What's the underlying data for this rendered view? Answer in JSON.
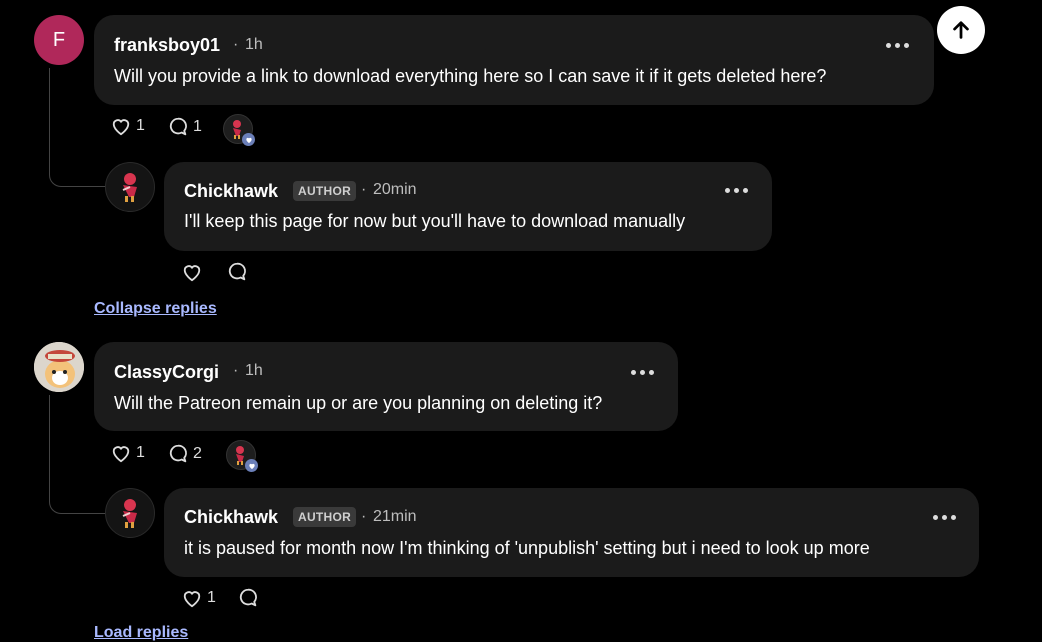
{
  "comments": [
    {
      "avatar_letter": "F",
      "author": "franksboy01",
      "time": "1h",
      "text": "Will you provide a link to download everything here so I can save it if it gets deleted here?",
      "likes": "1",
      "replies": "1",
      "reply": {
        "author": "Chickhawk",
        "badge": "AUTHOR",
        "time": "20min",
        "text": "I'll keep this page for now but you'll have to download manually",
        "likes": ""
      }
    },
    {
      "author": "ClassyCorgi",
      "time": "1h",
      "text": "Will the Patreon remain up or are you planning on deleting it?",
      "likes": "1",
      "replies": "2",
      "reply": {
        "author": "Chickhawk",
        "badge": "AUTHOR",
        "time": "21min",
        "text": "it is paused for month now I'm thinking of 'unpublish' setting but i need to look up more",
        "likes": "1"
      }
    }
  ],
  "collapse_label": "Collapse replies",
  "load_label": "Load replies",
  "separator": "·",
  "colors": {
    "background": "#000000",
    "bubble": "#1b1b1b",
    "avatar_letter_bg": "#b0285a",
    "link": "#a9b9ff",
    "badge_bg": "#3a3a3a"
  },
  "icons": [
    "heart-icon",
    "comment-icon",
    "more-dots-icon",
    "arrow-up-icon",
    "avatar-chickhawk-icon",
    "avatar-corgi-icon"
  ]
}
